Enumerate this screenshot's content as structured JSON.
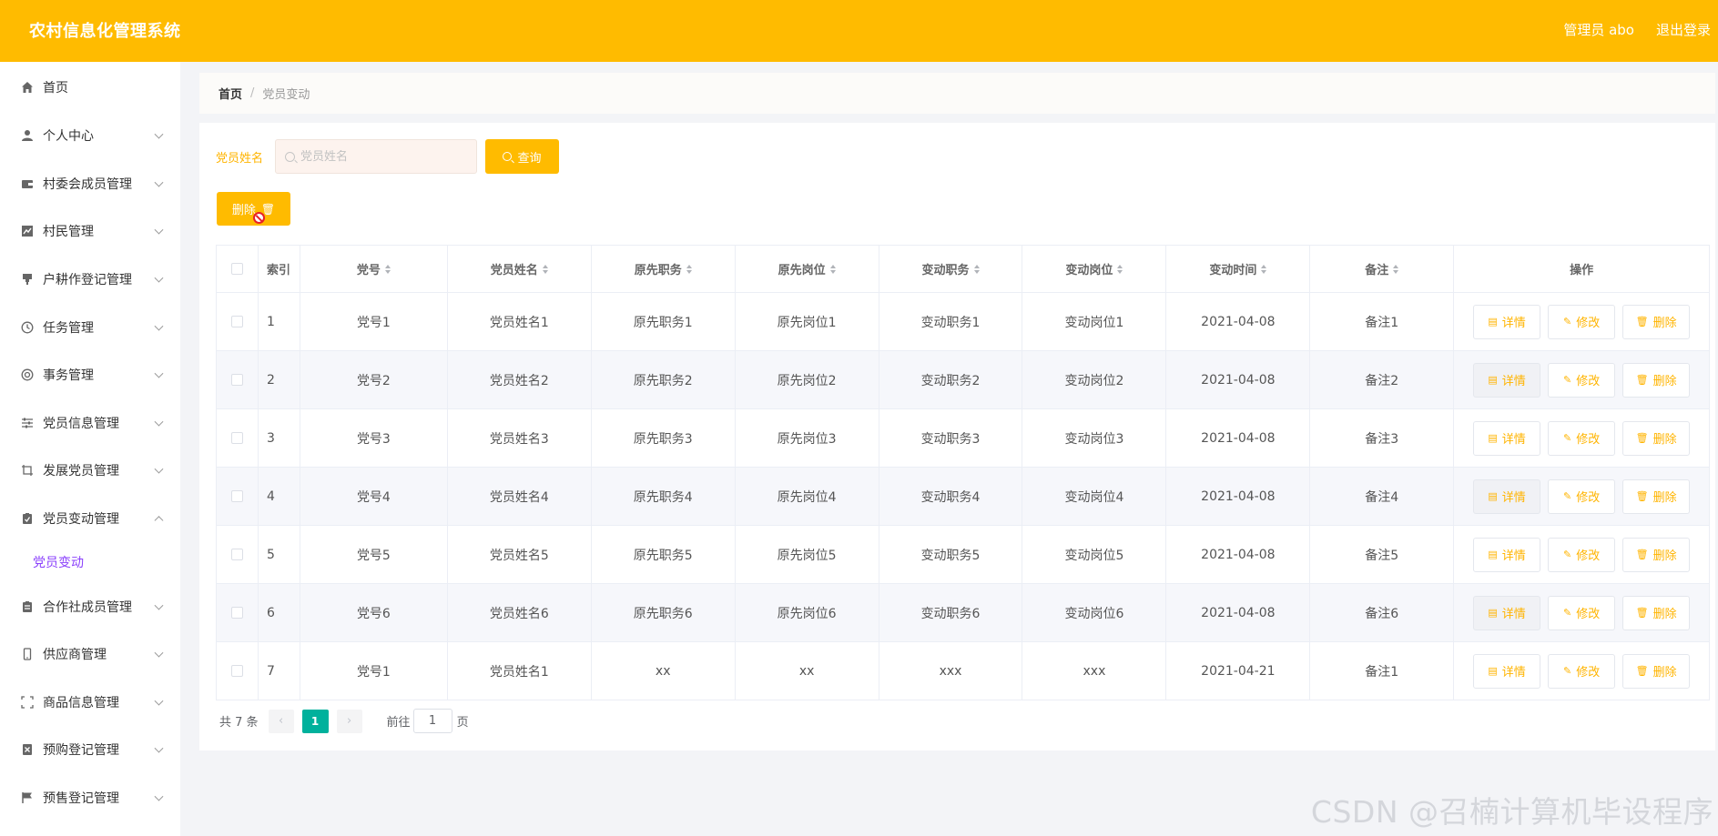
{
  "header": {
    "title": "农村信息化管理系统",
    "admin": "管理员 abo",
    "logout": "退出登录"
  },
  "sidebar": {
    "items": [
      {
        "label": "首页",
        "icon": "home-icon",
        "chevron": "none"
      },
      {
        "label": "个人中心",
        "icon": "user-icon",
        "chevron": "down"
      },
      {
        "label": "村委会成员管理",
        "icon": "wallet-icon",
        "chevron": "down"
      },
      {
        "label": "村民管理",
        "icon": "chart-icon",
        "chevron": "down"
      },
      {
        "label": "户耕作登记管理",
        "icon": "stamp-icon",
        "chevron": "down"
      },
      {
        "label": "任务管理",
        "icon": "clock-icon",
        "chevron": "down"
      },
      {
        "label": "事务管理",
        "icon": "lifebuoy-icon",
        "chevron": "down"
      },
      {
        "label": "党员信息管理",
        "icon": "sliders-icon",
        "chevron": "down"
      },
      {
        "label": "发展党员管理",
        "icon": "crop-icon",
        "chevron": "down"
      },
      {
        "label": "党员变动管理",
        "icon": "clipboard-check-icon",
        "chevron": "up"
      },
      {
        "label": "合作社成员管理",
        "icon": "clipboard-icon",
        "chevron": "down"
      },
      {
        "label": "供应商管理",
        "icon": "phone-icon",
        "chevron": "down"
      },
      {
        "label": "商品信息管理",
        "icon": "fullscreen-icon",
        "chevron": "down"
      },
      {
        "label": "预购登记管理",
        "icon": "x-square-icon",
        "chevron": "down"
      },
      {
        "label": "预售登记管理",
        "icon": "flag-icon",
        "chevron": "down"
      }
    ],
    "submenu_active": "党员变动"
  },
  "breadcrumb": {
    "home": "首页",
    "separator": "/",
    "current": "党员变动"
  },
  "search": {
    "label": "党员姓名",
    "placeholder": "党员姓名",
    "value": "",
    "button": "查询"
  },
  "toolbar": {
    "delete_label": "删除"
  },
  "table": {
    "headers": {
      "index": "索引",
      "cols": [
        "党号",
        "党员姓名",
        "原先职务",
        "原先岗位",
        "变动职务",
        "变动岗位",
        "变动时间",
        "备注"
      ],
      "op": "操作"
    },
    "rows": [
      {
        "idx": "1",
        "cells": [
          "党号1",
          "党员姓名1",
          "原先职务1",
          "原先岗位1",
          "变动职务1",
          "变动岗位1",
          "2021-04-08",
          "备注1"
        ]
      },
      {
        "idx": "2",
        "cells": [
          "党号2",
          "党员姓名2",
          "原先职务2",
          "原先岗位2",
          "变动职务2",
          "变动岗位2",
          "2021-04-08",
          "备注2"
        ]
      },
      {
        "idx": "3",
        "cells": [
          "党号3",
          "党员姓名3",
          "原先职务3",
          "原先岗位3",
          "变动职务3",
          "变动岗位3",
          "2021-04-08",
          "备注3"
        ]
      },
      {
        "idx": "4",
        "cells": [
          "党号4",
          "党员姓名4",
          "原先职务4",
          "原先岗位4",
          "变动职务4",
          "变动岗位4",
          "2021-04-08",
          "备注4"
        ]
      },
      {
        "idx": "5",
        "cells": [
          "党号5",
          "党员姓名5",
          "原先职务5",
          "原先岗位5",
          "变动职务5",
          "变动岗位5",
          "2021-04-08",
          "备注5"
        ]
      },
      {
        "idx": "6",
        "cells": [
          "党号6",
          "党员姓名6",
          "原先职务6",
          "原先岗位6",
          "变动职务6",
          "变动岗位6",
          "2021-04-08",
          "备注6"
        ]
      },
      {
        "idx": "7",
        "cells": [
          "党号1",
          "党员姓名1",
          "xx",
          "xx",
          "xxx",
          "xxx",
          "2021-04-21",
          "备注1"
        ]
      }
    ],
    "actions": {
      "detail": "详情",
      "edit": "修改",
      "delete": "删除"
    }
  },
  "pagination": {
    "total": "共 7 条",
    "prev": "‹",
    "current_page": "1",
    "next": "›",
    "goto_label": "前往",
    "goto_value": "1",
    "page_suffix": "页"
  },
  "watermark": "CSDN @召楠计算机毕设程序",
  "colors": {
    "accent": "#ffbb00",
    "pager_active": "#00b19c",
    "submenu_active": "#8a3ffc"
  }
}
